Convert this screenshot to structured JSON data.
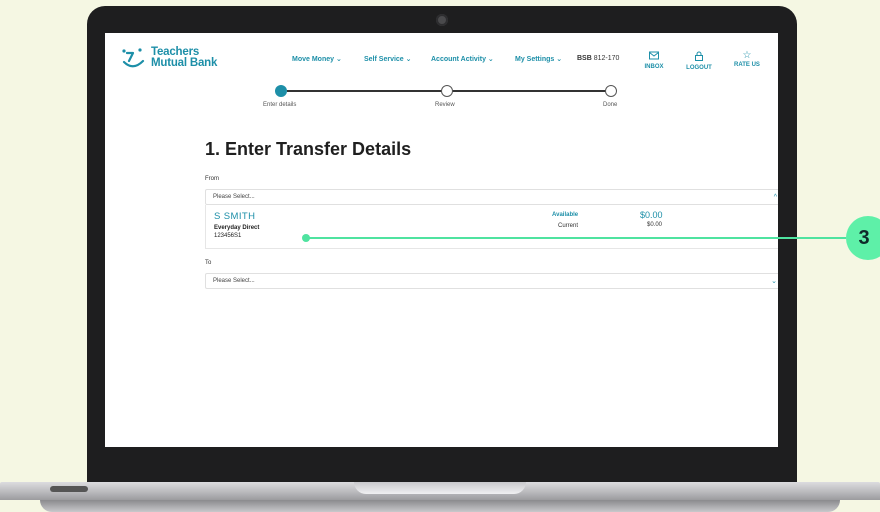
{
  "logo": {
    "line1": "Teachers",
    "line2": "Mutual Bank"
  },
  "nav": [
    {
      "label": "Move Money ⌄"
    },
    {
      "label": "Self Service ⌄"
    },
    {
      "label": "Account Activity ⌄"
    },
    {
      "label": "My Settings ⌄"
    }
  ],
  "bsb": {
    "label": "BSB",
    "value": "812-170"
  },
  "tools": {
    "inbox": "INBOX",
    "logout": "LOGOUT",
    "rate": "RATE US"
  },
  "stepper": {
    "step1": "Enter details",
    "step2": "Review",
    "step3": "Done",
    "current": 1
  },
  "page_title": "1. Enter Transfer Details",
  "from": {
    "label": "From",
    "placeholder": "Please Select...",
    "account": {
      "name": "S SMITH",
      "type": "Everyday Direct",
      "number": "123456S1",
      "available_label": "Available",
      "available_value": "$0.00",
      "current_label": "Current",
      "current_value": "$0.00"
    }
  },
  "to": {
    "label": "To",
    "placeholder": "Please Select..."
  },
  "callout": {
    "number": "3"
  },
  "colors": {
    "accent": "#1d8fa8",
    "callout": "#4fe3a0",
    "background": "#f5f7e3"
  }
}
